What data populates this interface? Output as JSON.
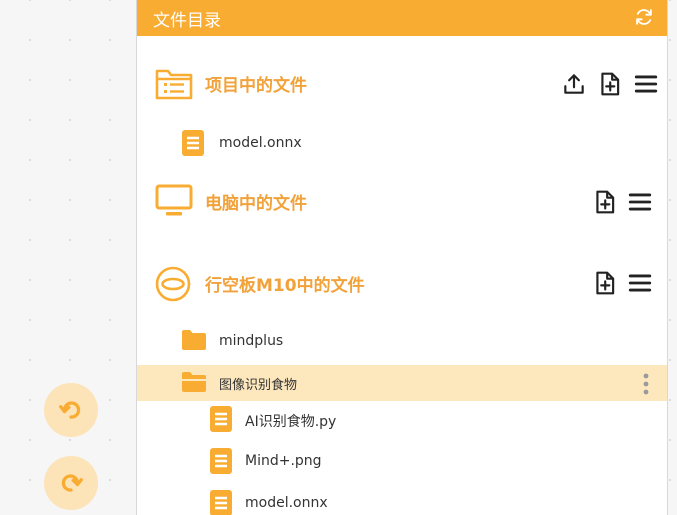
{
  "panel": {
    "title": "文件目录"
  },
  "sections": {
    "project": {
      "title": "项目中的文件"
    },
    "computer": {
      "title": "电脑中的文件"
    },
    "device": {
      "title": "行空板M10中的文件"
    }
  },
  "project_files": [
    {
      "label": "model.onnx"
    }
  ],
  "device_files": [
    {
      "label": "mindplus"
    },
    {
      "label": "图像识别食物"
    },
    {
      "label": "AI识别食物.py"
    },
    {
      "label": "Mind+.png"
    },
    {
      "label": "model.onnx"
    }
  ],
  "colors": {
    "accent": "#f9ac32",
    "title": "#f2a23a",
    "selected": "#fde8be",
    "round_button": "#fde3b8"
  },
  "icons": {
    "refresh": "refresh-icon",
    "upload": "upload-icon",
    "new_file": "new-file-icon",
    "menu": "menu-icon",
    "undo": "undo-icon",
    "redo": "redo-icon"
  }
}
